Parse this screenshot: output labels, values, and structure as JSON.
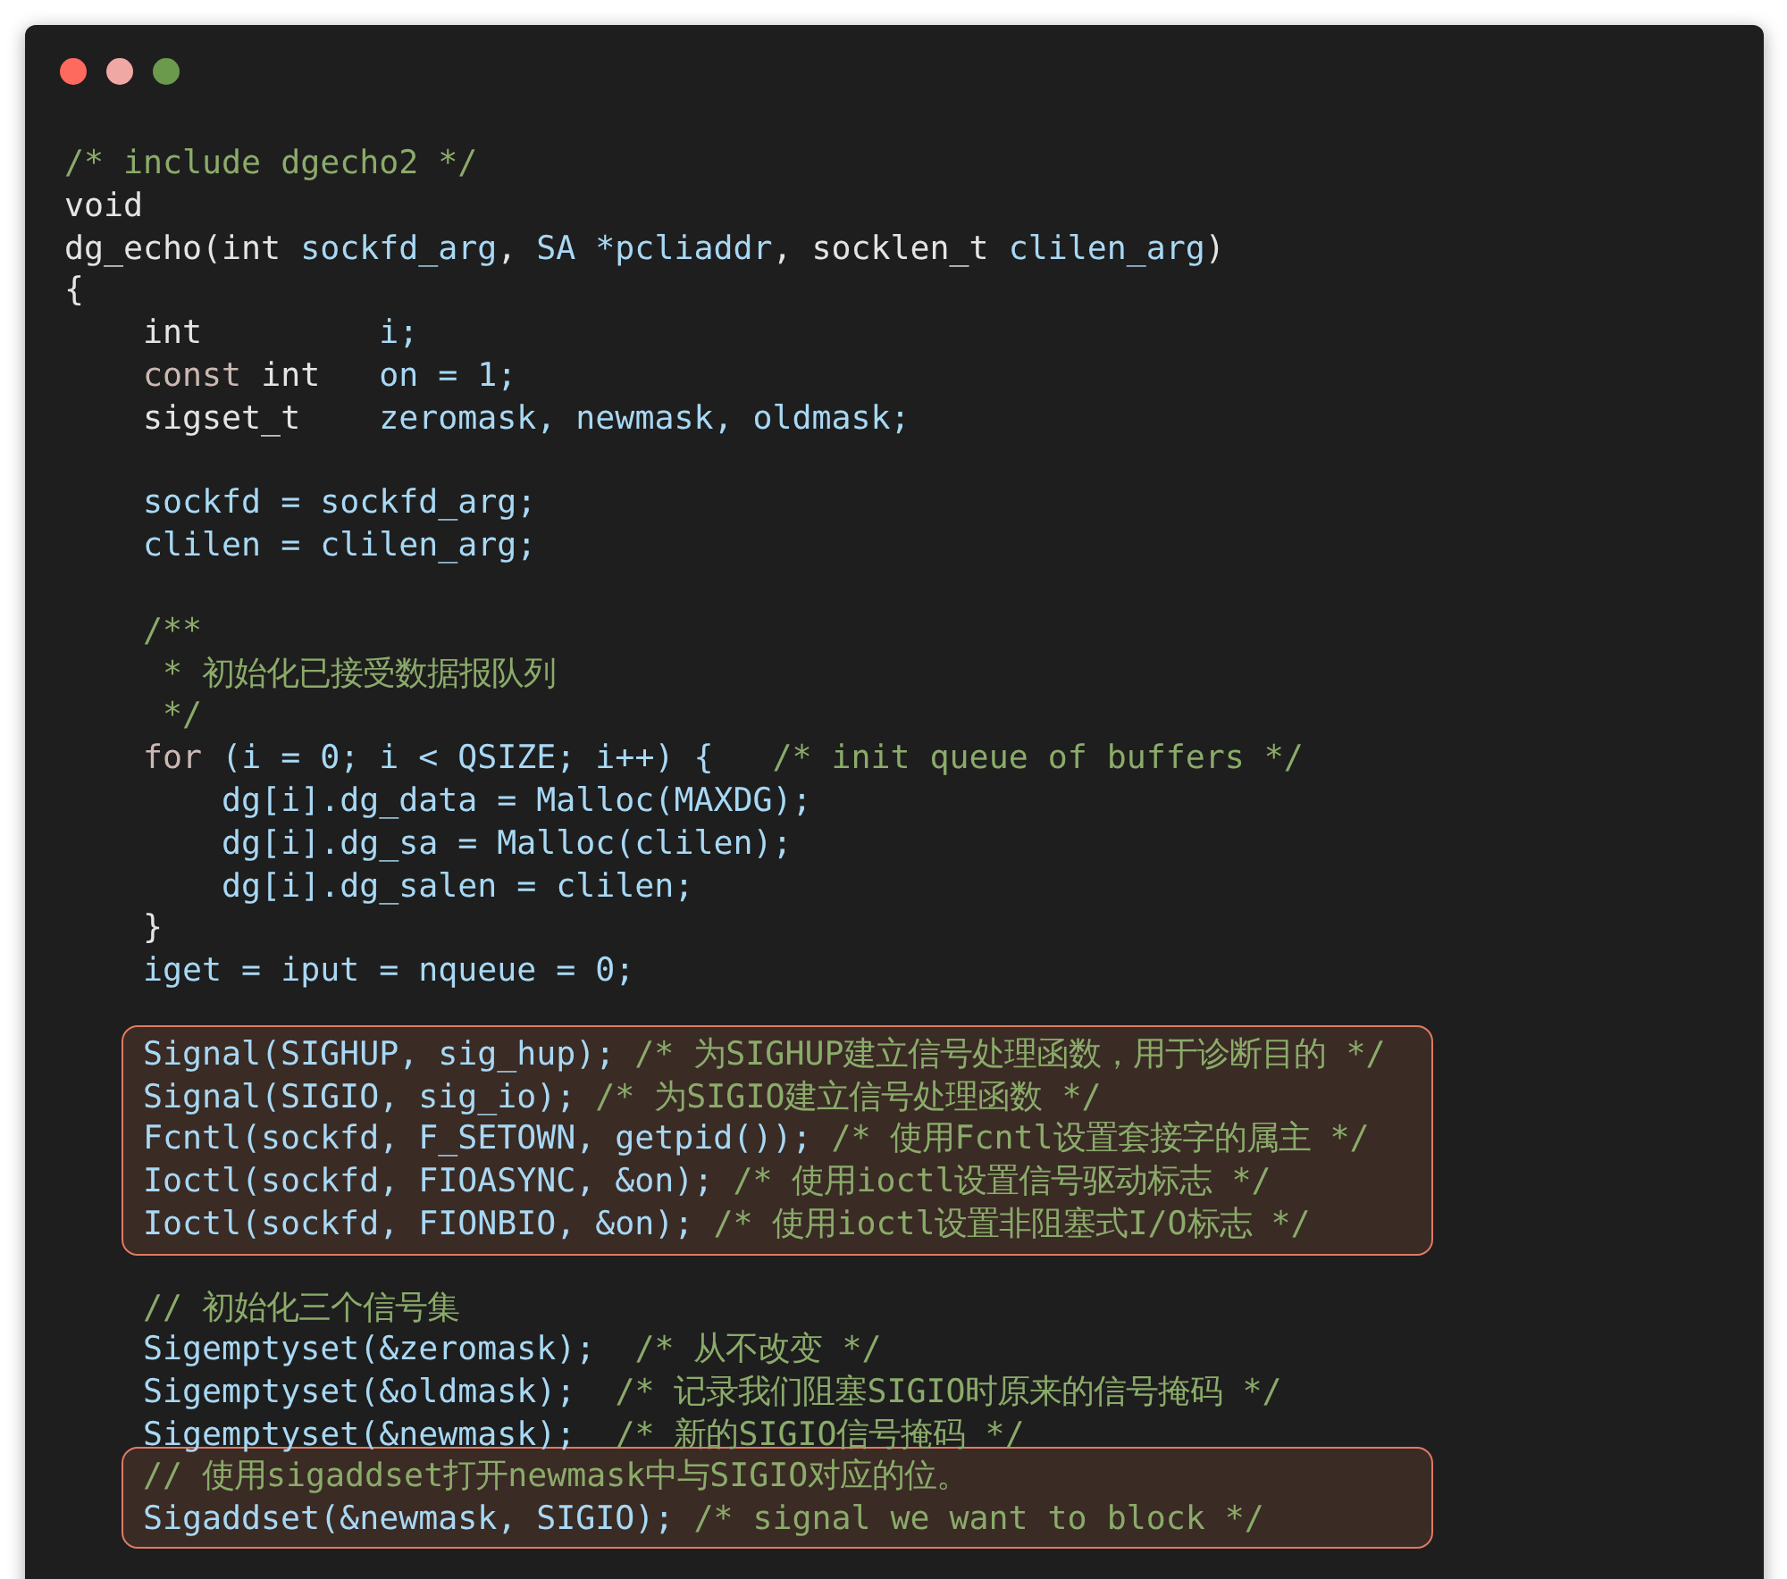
{
  "paragraphs": [
    {
      "groups": [
        {
          "highlighted": false,
          "lines": [
            [
              {
                "kind": "comment",
                "text": "/* include dgecho2 */"
              }
            ],
            [
              {
                "kind": "plain",
                "text": "void"
              }
            ],
            [
              {
                "kind": "plain",
                "text": "dg_echo(int "
              },
              {
                "kind": "var",
                "text": "sockfd_arg"
              },
              {
                "kind": "plain",
                "text": ", "
              },
              {
                "kind": "var",
                "text": "SA *pcliaddr"
              },
              {
                "kind": "plain",
                "text": ", socklen_t "
              },
              {
                "kind": "var",
                "text": "clilen_arg"
              },
              {
                "kind": "plain",
                "text": ")"
              }
            ],
            [
              {
                "kind": "plain",
                "text": "{"
              }
            ],
            [
              {
                "kind": "plain",
                "text": "    int         "
              },
              {
                "kind": "var",
                "text": "i;"
              }
            ],
            [
              {
                "kind": "keyword",
                "text": "    const "
              },
              {
                "kind": "plain",
                "text": "int   "
              },
              {
                "kind": "var",
                "text": "on = 1;"
              }
            ],
            [
              {
                "kind": "plain",
                "text": "    sigset_t    "
              },
              {
                "kind": "var",
                "text": "zeromask, newmask, oldmask;"
              }
            ]
          ]
        }
      ]
    },
    {
      "groups": [
        {
          "highlighted": false,
          "lines": [
            [
              {
                "kind": "var",
                "text": "    sockfd = sockfd_arg;"
              }
            ],
            [
              {
                "kind": "var",
                "text": "    clilen = clilen_arg;"
              }
            ]
          ]
        }
      ]
    },
    {
      "groups": [
        {
          "highlighted": false,
          "lines": [
            [
              {
                "kind": "comment",
                "text": "    /**"
              }
            ],
            [
              {
                "kind": "comment",
                "text": "     * 初始化已接受数据报队列"
              }
            ],
            [
              {
                "kind": "comment",
                "text": "     */"
              }
            ],
            [
              {
                "kind": "keyword",
                "text": "    for "
              },
              {
                "kind": "var",
                "text": "(i = 0; i < QSIZE; i++) {   "
              },
              {
                "kind": "comment",
                "text": "/* init queue of buffers */"
              }
            ],
            [
              {
                "kind": "var",
                "text": "        dg[i].dg_data = Malloc(MAXDG);"
              }
            ],
            [
              {
                "kind": "var",
                "text": "        dg[i].dg_sa = Malloc(clilen);"
              }
            ],
            [
              {
                "kind": "var",
                "text": "        dg[i].dg_salen = clilen;"
              }
            ],
            [
              {
                "kind": "plain",
                "text": "    }"
              }
            ],
            [
              {
                "kind": "var",
                "text": "    iget = iput = nqueue = 0;"
              }
            ]
          ]
        }
      ]
    },
    {
      "groups": [
        {
          "highlighted": true,
          "lines": [
            [
              {
                "kind": "var",
                "text": "Signal(SIGHUP, sig_hup); "
              },
              {
                "kind": "comment",
                "text": "/* 为SIGHUP建立信号处理函数，用于诊断目的 */"
              }
            ],
            [
              {
                "kind": "var",
                "text": "Signal(SIGIO, sig_io); "
              },
              {
                "kind": "comment",
                "text": "/* 为SIGIO建立信号处理函数 */"
              }
            ],
            [
              {
                "kind": "var",
                "text": "Fcntl(sockfd, F_SETOWN, getpid()); "
              },
              {
                "kind": "comment",
                "text": "/* 使用Fcntl设置套接字的属主 */"
              }
            ],
            [
              {
                "kind": "var",
                "text": "Ioctl(sockfd, FIOASYNC, &on); "
              },
              {
                "kind": "comment",
                "text": "/* 使用ioctl设置信号驱动标志 */"
              }
            ],
            [
              {
                "kind": "var",
                "text": "Ioctl(sockfd, FIONBIO, &on); "
              },
              {
                "kind": "comment",
                "text": "/* 使用ioctl设置非阻塞式I/O标志 */"
              }
            ]
          ]
        }
      ]
    },
    {
      "groups": [
        {
          "highlighted": false,
          "lines": [
            [
              {
                "kind": "comment",
                "text": "    // 初始化三个信号集"
              }
            ],
            [
              {
                "kind": "var",
                "text": "    Sigemptyset(&zeromask);  "
              },
              {
                "kind": "comment",
                "text": "/* 从不改变 */"
              }
            ],
            [
              {
                "kind": "var",
                "text": "    Sigemptyset(&oldmask);  "
              },
              {
                "kind": "comment",
                "text": "/* 记录我们阻塞SIGIO时原来的信号掩码 */"
              }
            ],
            [
              {
                "kind": "var",
                "text": "    Sigemptyset(&newmask);  "
              },
              {
                "kind": "comment",
                "text": "/* 新的SIGIO信号掩码 */"
              }
            ]
          ]
        },
        {
          "highlighted": true,
          "lines": [
            [
              {
                "kind": "comment",
                "text": "// 使用sigaddset打开newmask中与SIGIO对应的位。"
              }
            ],
            [
              {
                "kind": "var",
                "text": "Sigaddset(&newmask, SIGIO); "
              },
              {
                "kind": "comment",
                "text": "/* signal we want to block */"
              }
            ]
          ]
        }
      ]
    }
  ]
}
